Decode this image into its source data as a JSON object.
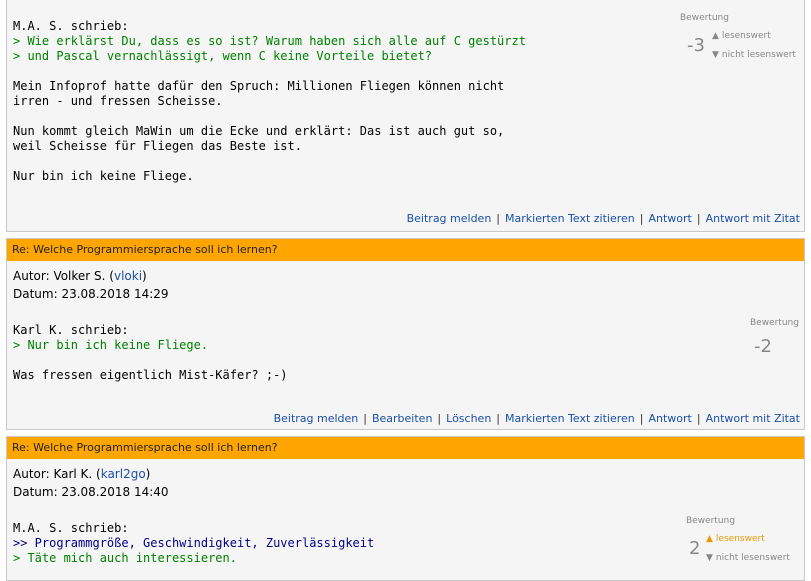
{
  "posts": [
    {
      "lines": [
        {
          "text": "M.A. S. schrieb:",
          "type": "plain"
        },
        {
          "text": "> Wie erklärst Du, dass es so ist? Warum haben sich alle auf C gestürzt",
          "type": "q1"
        },
        {
          "text": "> und Pascal vernachlässigt, wenn C keine Vorteile bietet?",
          "type": "q1"
        },
        {
          "text": "",
          "type": "plain"
        },
        {
          "text": "Mein Infoprof hatte dafür den Spruch: Millionen Fliegen können nicht",
          "type": "plain"
        },
        {
          "text": "irren - und fressen Scheisse.",
          "type": "plain"
        },
        {
          "text": "",
          "type": "plain"
        },
        {
          "text": "Nun kommt gleich MaWin um die Ecke und erklärt: Das ist auch gut so,",
          "type": "plain"
        },
        {
          "text": "weil Scheisse für Fliegen das Beste ist.",
          "type": "plain"
        },
        {
          "text": "",
          "type": "plain"
        },
        {
          "text": "Nur bin ich keine Fliege.",
          "type": "plain"
        }
      ],
      "rating": {
        "label": "Bewertung",
        "score": "-3",
        "up": "lesenswert",
        "down": "nicht lesenswert"
      },
      "actions": [
        "Beitrag melden",
        "Markierten Text zitieren",
        "Antwort",
        "Antwort mit Zitat"
      ]
    },
    {
      "title": "Re: Welche Programmiersprache soll ich lernen?",
      "author_prefix": "Autor: Volker S. (",
      "author_user": "vloki",
      "author_suffix": ")",
      "date": "Datum: 23.08.2018 14:29",
      "lines": [
        {
          "text": "Karl K. schrieb:",
          "type": "plain"
        },
        {
          "text": "> Nur bin ich keine Fliege.",
          "type": "q1"
        },
        {
          "text": "",
          "type": "plain"
        },
        {
          "text": "Was fressen eigentlich Mist-Käfer? ;-)",
          "type": "plain"
        }
      ],
      "rating": {
        "label": "Bewertung",
        "score": "-2"
      },
      "actions": [
        "Beitrag melden",
        "Bearbeiten",
        "Löschen",
        "Markierten Text zitieren",
        "Antwort",
        "Antwort mit Zitat"
      ]
    },
    {
      "title": "Re: Welche Programmiersprache soll ich lernen?",
      "author_prefix": "Autor: Karl K. (",
      "author_user": "karl2go",
      "author_suffix": ")",
      "date": "Datum: 23.08.2018 14:40",
      "lines": [
        {
          "text": "M.A. S. schrieb:",
          "type": "plain"
        },
        {
          "text": ">> Programmgröße, Geschwindigkeit, Zuverlässigkeit",
          "type": "q2"
        },
        {
          "text": "> Täte mich auch interessieren.",
          "type": "q1"
        }
      ],
      "rating": {
        "label": "Bewertung",
        "score": "2",
        "up": "lesenswert",
        "down": "nicht lesenswert"
      }
    }
  ],
  "colors": {
    "header": "#ffa500",
    "quote_level1": "#008000",
    "quote_level2": "#00008b",
    "link": "#1a4fa8",
    "vote_active": "#e89a00"
  },
  "icons": {
    "up": "triangle-up-icon",
    "down": "triangle-down-icon"
  }
}
